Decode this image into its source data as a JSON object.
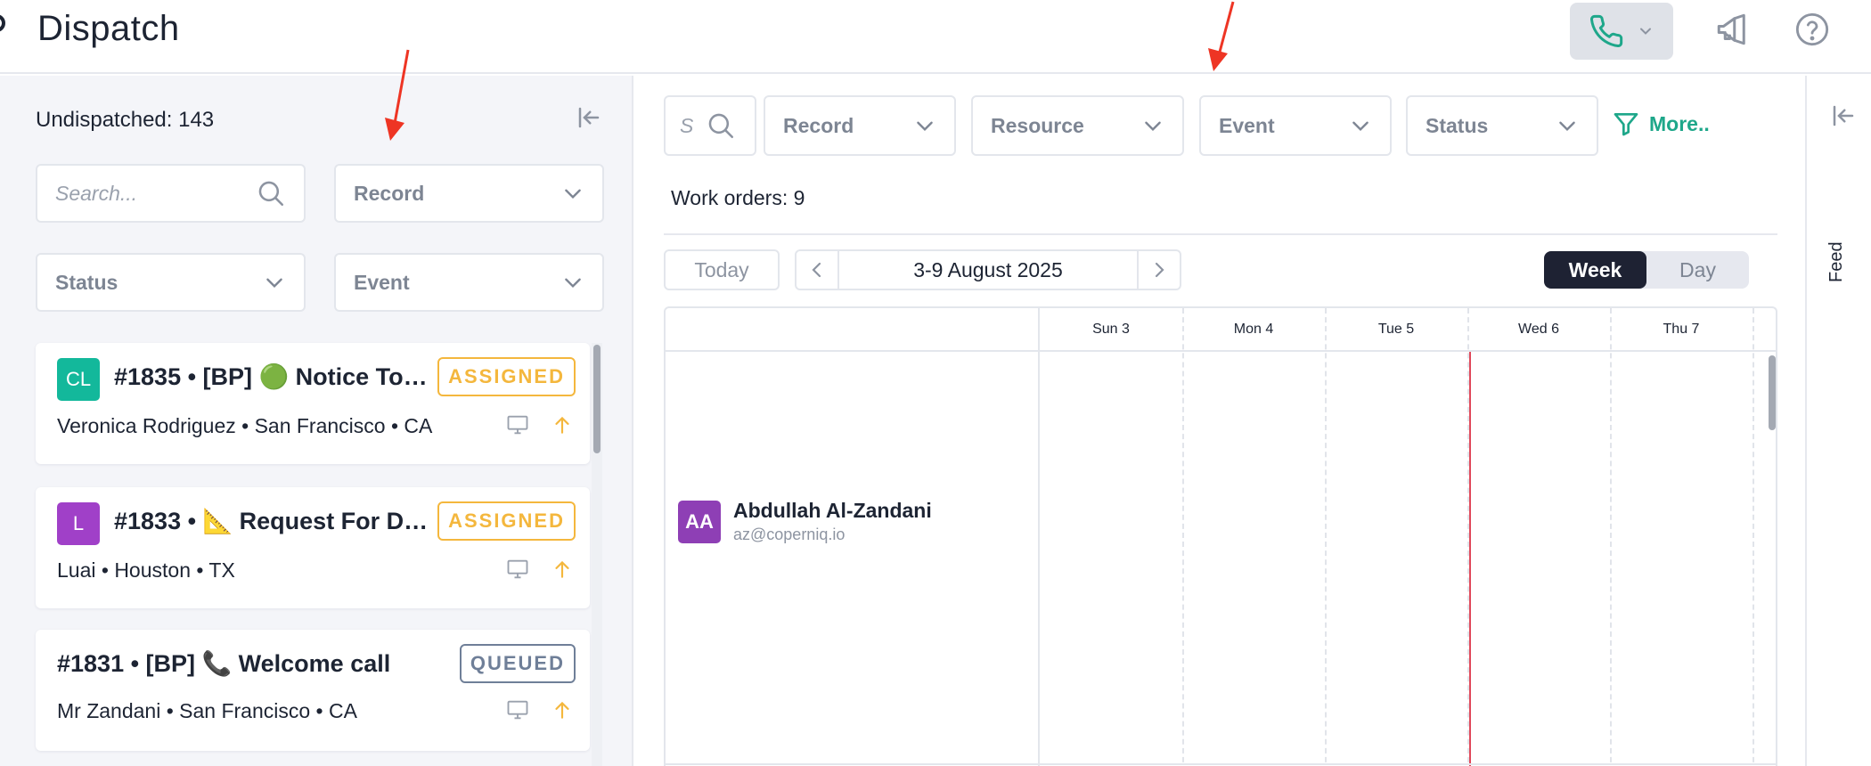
{
  "app": {
    "title": "Dispatch"
  },
  "header": {
    "phone_icon": "phone-icon",
    "announce_icon": "megaphone-icon",
    "help_icon": "help-icon"
  },
  "left_panel": {
    "undispatched_label": "Undispatched: 143",
    "search_placeholder": "Search...",
    "filters": {
      "record": "Record",
      "status": "Status",
      "event": "Event"
    },
    "cards": [
      {
        "avatar": "CL",
        "avatar_color": "#13b89b",
        "title": "#1835 • [BP] 🟢 Notice To…",
        "subtitle": "Veronica Rodriguez • San Francisco • CA",
        "badge": "ASSIGNED"
      },
      {
        "avatar": "L",
        "avatar_color": "#a040c8",
        "title": "#1833 • 📐 Request For D…",
        "subtitle": "Luai • Houston • TX",
        "badge": "ASSIGNED"
      },
      {
        "avatar": "",
        "avatar_color": "",
        "title": "#1831 • [BP] 📞 Welcome call",
        "subtitle": "Mr Zandani • San Francisco • CA",
        "badge": "QUEUED"
      }
    ]
  },
  "main": {
    "search_letter": "S",
    "filters": {
      "record": "Record",
      "resource": "Resource",
      "event": "Event",
      "status": "Status",
      "more": "More.."
    },
    "work_orders_label": "Work orders: 9",
    "today_label": "Today",
    "date_range": "3-9 August 2025",
    "view_week": "Week",
    "view_day": "Day",
    "active_view": "Week",
    "days": [
      "Sun 3",
      "Mon 4",
      "Tue 5",
      "Wed 6",
      "Thu 7"
    ],
    "resource": {
      "initials": "AA",
      "name": "Abdullah Al-Zandani",
      "email": "az@coperniq.io"
    }
  },
  "right_rail": {
    "feed_label": "Feed"
  },
  "colors": {
    "accent_teal": "#1ea78a",
    "assigned": "#f4b73d",
    "queued": "#6f7f98",
    "now_line": "#e0485a",
    "annotation_arrow": "#ee3524"
  }
}
